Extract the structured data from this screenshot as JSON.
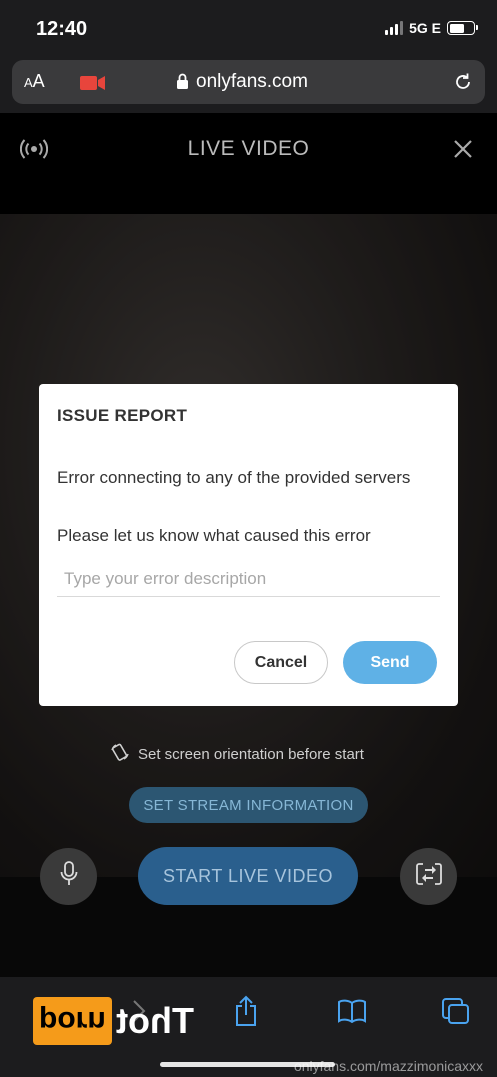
{
  "status_bar": {
    "time": "12:40",
    "network": "5G E"
  },
  "browser": {
    "text_size_label": "AA",
    "url": "onlyfans.com"
  },
  "live": {
    "title": "LIVE VIDEO",
    "orientation_hint": "Set screen orientation before start",
    "stream_info_label": "SET STREAM INFORMATION",
    "start_label": "START LIVE VIDEO"
  },
  "modal": {
    "title": "ISSUE REPORT",
    "message": "Error connecting to any of the provided servers",
    "prompt": "Please let us know what caused this error",
    "input_placeholder": "Type your error description",
    "input_value": "",
    "cancel_label": "Cancel",
    "send_label": "Send"
  },
  "watermark": {
    "logo_box_text": "porn",
    "logo_text": "Thot",
    "url": "onlyfans.com/mazzimonicaxxx"
  },
  "colors": {
    "accent": "#5fb1e6",
    "record_red": "#e8453c",
    "logo_orange": "#f59b1a"
  },
  "icons": {
    "camera": "video-camera-icon",
    "lock": "lock-icon",
    "reload": "reload-icon",
    "broadcast": "broadcast-icon",
    "close": "close-icon",
    "orientation": "rotate-phone-icon",
    "mic": "microphone-icon",
    "switch_camera": "switch-camera-icon",
    "share": "share-icon",
    "bookmarks": "book-icon",
    "tabs": "tabs-icon"
  }
}
